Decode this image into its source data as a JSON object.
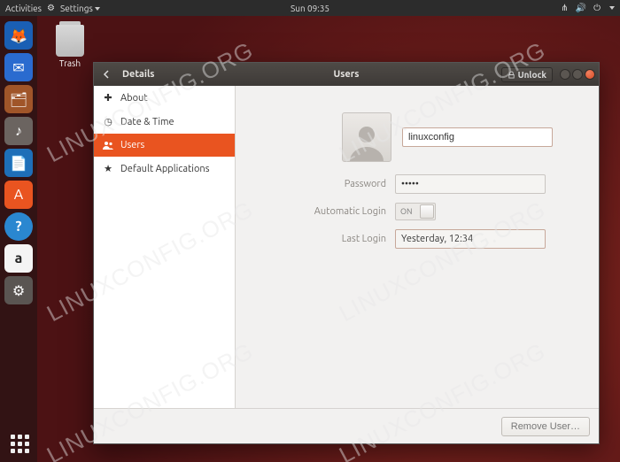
{
  "top_panel": {
    "activities": "Activities",
    "app_menu": "Settings",
    "clock": "Sun 09:35"
  },
  "desktop": {
    "trash_label": "Trash"
  },
  "dock_items": [
    {
      "name": "firefox",
      "bg": "#1a5fb4",
      "glyph": "🦊"
    },
    {
      "name": "thunderbird",
      "bg": "#2a6bcf",
      "glyph": "✉"
    },
    {
      "name": "files",
      "bg": "#a05529",
      "glyph": "🗂"
    },
    {
      "name": "rhythmbox",
      "bg": "#6b6460",
      "glyph": "♪"
    },
    {
      "name": "writer",
      "bg": "#1e6fb8",
      "glyph": "📄"
    },
    {
      "name": "software",
      "bg": "#e95420",
      "glyph": "A"
    },
    {
      "name": "help",
      "bg": "#2a87d0",
      "glyph": "?"
    },
    {
      "name": "amazon",
      "bg": "#f4f4f4",
      "glyph": "a"
    },
    {
      "name": "settings",
      "bg": "#5a5552",
      "glyph": "⚙"
    }
  ],
  "window": {
    "back_section": "Details",
    "title": "Users",
    "unlock_label": "Unlock"
  },
  "sidebar": {
    "items": [
      {
        "icon": "plus",
        "label": "About"
      },
      {
        "icon": "clock",
        "label": "Date & Time"
      },
      {
        "icon": "users",
        "label": "Users"
      },
      {
        "icon": "star",
        "label": "Default Applications"
      }
    ]
  },
  "user": {
    "name": "linuxconfig",
    "password_label": "Password",
    "password_value": "•••••",
    "autologin_label": "Automatic Login",
    "autologin_state": "ON",
    "lastlogin_label": "Last Login",
    "lastlogin_value": "Yesterday, 12:34"
  },
  "footer": {
    "remove_user": "Remove User…"
  },
  "watermark": "LINUXCONFIG.ORG"
}
